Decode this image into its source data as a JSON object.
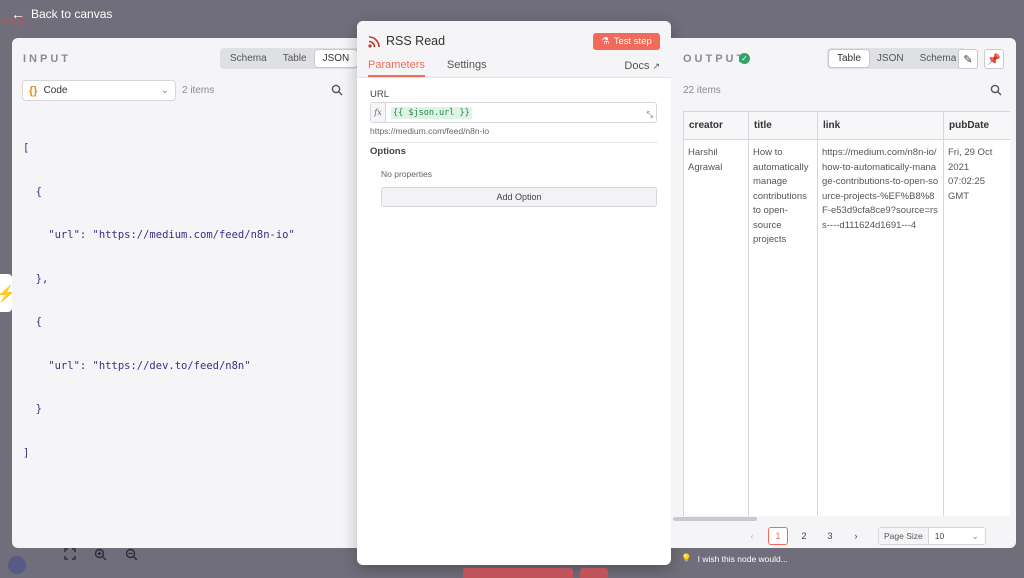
{
  "topbar": {
    "back_label": "Back to canvas"
  },
  "input": {
    "title": "INPUT",
    "view_tabs": [
      "Schema",
      "Table",
      "JSON"
    ],
    "active_view": "JSON",
    "source_select": "Code",
    "items_count": "2 items",
    "json_lines": [
      "[",
      "  {",
      "    \"url\": \"https://medium.com/feed/n8n-io\"",
      "  },",
      "  {",
      "    \"url\": \"https://dev.to/feed/n8n\"",
      "  }",
      "]"
    ]
  },
  "node": {
    "title": "RSS Read",
    "test_label": "Test step",
    "tabs": [
      "Parameters",
      "Settings"
    ],
    "active_tab": "Parameters",
    "docs_label": "Docs",
    "url_label": "URL",
    "url_expression": "{{ $json.url }}",
    "url_preview": "https://medium.com/feed/n8n-io",
    "options_label": "Options",
    "no_properties": "No properties",
    "add_option": "Add Option"
  },
  "output": {
    "title": "OUTPUT",
    "view_tabs": [
      "Table",
      "JSON",
      "Schema"
    ],
    "active_view": "Table",
    "items_count": "22 items",
    "columns": [
      "creator",
      "title",
      "link",
      "pubDate"
    ],
    "row": [
      "Harshil Agrawal",
      "How to automatically manage contributions to open-source projects",
      "https://medium.com/n8n-io/how-to-automatically-manage-contributions-to-open-source-projects-%EF%B8%8F-e53d9cfa8ce9?source=rss----d111624d1691---4",
      "Fri, 29 Oct 2021 07:02:25 GMT"
    ],
    "pages": [
      "1",
      "2",
      "3"
    ],
    "active_page": "1",
    "page_size_label": "Page Size",
    "page_size": "10"
  },
  "feedback": "I wish this node would...",
  "colors": {
    "accent": "#f26a5a",
    "success": "#2fa56a"
  }
}
